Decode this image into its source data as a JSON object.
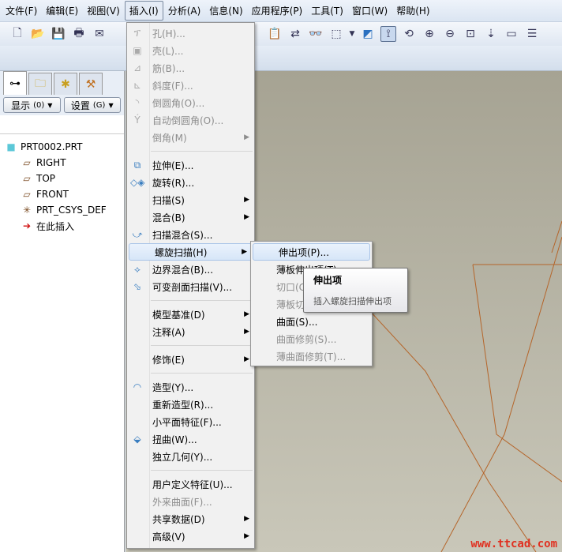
{
  "menubar": [
    "文件(F)",
    "编辑(E)",
    "视图(V)",
    "插入(I)",
    "分析(A)",
    "信息(N)",
    "应用程序(P)",
    "工具(T)",
    "窗口(W)",
    "帮助(H)"
  ],
  "panel": {
    "show_label": "显示",
    "show_key": "(0)",
    "settings_label": "设置",
    "settings_key": "(G)"
  },
  "tree": [
    {
      "label": "PRT0002.PRT",
      "icon": "part-icon"
    },
    {
      "label": "RIGHT",
      "icon": "datum-plane-icon"
    },
    {
      "label": "TOP",
      "icon": "datum-plane-icon"
    },
    {
      "label": "FRONT",
      "icon": "datum-plane-icon"
    },
    {
      "label": "PRT_CSYS_DEF",
      "icon": "csys-icon"
    },
    {
      "label": "在此插入",
      "icon": "insert-here-arrow-icon"
    }
  ],
  "insert_menu": [
    {
      "label": "孔(H)...",
      "disabled": true
    },
    {
      "label": "壳(L)...",
      "disabled": true
    },
    {
      "label": "筋(B)...",
      "disabled": true
    },
    {
      "label": "斜度(F)...",
      "disabled": true
    },
    {
      "label": "倒圆角(O)...",
      "disabled": true
    },
    {
      "label": "自动倒圆角(O)...",
      "disabled": true
    },
    {
      "label": "倒角(M)",
      "disabled": true,
      "submenu": true
    },
    {
      "label": "拉伸(E)..."
    },
    {
      "label": "旋转(R)..."
    },
    {
      "label": "扫描(S)",
      "submenu": true
    },
    {
      "label": "混合(B)",
      "submenu": true
    },
    {
      "label": "扫描混合(S)..."
    },
    {
      "label": "螺旋扫描(H)",
      "submenu": true,
      "highlighted": true
    },
    {
      "label": "边界混合(B)..."
    },
    {
      "label": "可变剖面扫描(V)..."
    },
    {
      "label": "模型基准(D)",
      "submenu": true
    },
    {
      "label": "注释(A)",
      "submenu": true
    },
    {
      "label": "修饰(E)",
      "submenu": true
    },
    {
      "label": "造型(Y)..."
    },
    {
      "label": "重新造型(R)..."
    },
    {
      "label": "小平面特征(F)..."
    },
    {
      "label": "扭曲(W)..."
    },
    {
      "label": "独立几何(Y)..."
    },
    {
      "label": "用户定义特征(U)..."
    },
    {
      "label": "外来曲面(F)...",
      "disabled": true
    },
    {
      "label": "共享数据(D)",
      "submenu": true
    },
    {
      "label": "高级(V)",
      "submenu": true
    }
  ],
  "helical_submenu": [
    {
      "label": "伸出项(P)...",
      "highlighted": true
    },
    {
      "label": "薄板伸出项(T)..."
    },
    {
      "label": "切口(C)...",
      "disabled": true
    },
    {
      "label": "薄板切口(U)...",
      "disabled": true
    },
    {
      "label": "曲面(S)..."
    },
    {
      "label": "曲面修剪(S)...",
      "disabled": true
    },
    {
      "label": "薄曲面修剪(T)...",
      "disabled": true
    }
  ],
  "tooltip": {
    "title": "伸出项",
    "description": "插入螺旋扫描伸出项"
  },
  "watermark": "www.ttcad.com",
  "colors": {
    "geometry_lines": "#b5652a",
    "watermark": "#e03020"
  }
}
